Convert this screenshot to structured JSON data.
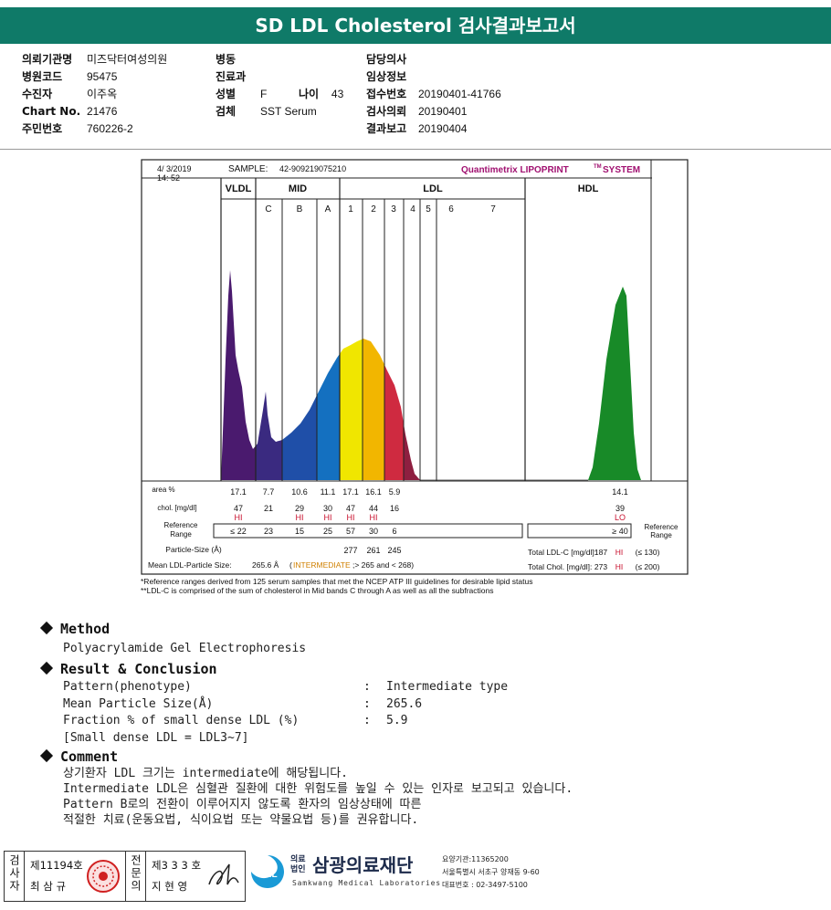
{
  "title": "SD LDL Cholesterol 검사결과보고서",
  "header": {
    "col1": [
      {
        "label": "의뢰기관명",
        "value": "미즈닥터여성의원"
      },
      {
        "label": "병원코드",
        "value": "95475"
      },
      {
        "label": "수진자",
        "value": "이주옥"
      },
      {
        "label": "Chart No.",
        "value": "21476"
      },
      {
        "label": "주민번호",
        "value": "760226-2"
      }
    ],
    "col2": [
      {
        "label": "병동",
        "value": ""
      },
      {
        "label": "진료과",
        "value": ""
      },
      {
        "label": "성별",
        "value": "F"
      },
      {
        "label": "검체",
        "value": "SST Serum"
      }
    ],
    "age_label": "나이",
    "age_value": "43",
    "col3": [
      {
        "label": "담당의사",
        "value": ""
      },
      {
        "label": "임상정보",
        "value": ""
      },
      {
        "label": "접수번호",
        "value": "20190401-41766"
      },
      {
        "label": "검사의뢰",
        "value": "20190401"
      },
      {
        "label": "결과보고",
        "value": "20190404"
      }
    ]
  },
  "chart_data": {
    "type": "area",
    "datetime": "4/ 3/2019",
    "time": "14: 52",
    "sample_label": "SAMPLE:",
    "sample_id": "42-909219075210",
    "system": "Quantimetrix LIPOPRINT",
    "system_tm": "TM",
    "system_suffix": "SYSTEM",
    "groups": [
      "VLDL",
      "MID",
      "LDL",
      "HDL"
    ],
    "bands": [
      "C",
      "B",
      "A",
      "1",
      "2",
      "3",
      "4",
      "5",
      "6",
      "7"
    ],
    "band_colors": {
      "VLDL": "#4a1a6e",
      "C": "#3a2a80",
      "B": "#1f4fa8",
      "A": "#1470c0",
      "1": "#f0e600",
      "2": "#f2b600",
      "3": "#cf2a40",
      "4": "#8e1f40",
      "5": "#8e1f40",
      "6": "#8e1f40",
      "7": "#8e1f40",
      "HDL": "#188a28"
    },
    "area_label": "area %",
    "area": [
      "17.1",
      "7.7",
      "10.6",
      "11.1",
      "17.1",
      "16.1",
      "5.9",
      "14.1"
    ],
    "chol_label": "chol. [mg/dl]",
    "chol": [
      "47",
      "21",
      "29",
      "30",
      "47",
      "44",
      "16",
      "39"
    ],
    "flags": [
      "HI",
      "",
      "HI",
      "HI",
      "HI",
      "HI",
      "",
      "LO"
    ],
    "ref_label": "Reference Range",
    "ref": [
      "≤ 22",
      "23",
      "15",
      "25",
      "57",
      "30",
      "6",
      "≥ 40"
    ],
    "particle_label": "Particle-Size (Å)",
    "particle": [
      "277",
      "261",
      "245"
    ],
    "mean_label": "Mean LDL-Particle Size:",
    "mean_value": "265.6 Å",
    "mean_class": "INTERMEDIATE",
    "mean_range": ";> 265 and < 268)",
    "total_ldl_label": "Total LDL-C [mg/dl]:",
    "total_ldl": "187",
    "total_ldl_flag": "HI",
    "total_ldl_ref": "(≤ 130)",
    "total_chol_label": "Total Chol. [mg/dl]:",
    "total_chol": "273",
    "total_chol_flag": "HI",
    "total_chol_ref": "(≤ 200)",
    "colors": {
      "flag": "#c8102e",
      "system": "#a01070",
      "intermediate": "#d08000"
    }
  },
  "footnotes": [
    "*Reference ranges derived from 125 serum samples that met the NCEP ATP III guidelines for desirable lipid status",
    "**LDL-C is comprised of the sum of cholesterol in Mid bands C through A as well as all the subfractions"
  ],
  "method": {
    "heading": "Method",
    "text": "Polyacrylamide Gel Electrophoresis"
  },
  "result": {
    "heading": "Result & Conclusion",
    "rows": [
      {
        "label": "Pattern(phenotype)",
        "value": "Intermediate type"
      },
      {
        "label": "Mean Particle Size(Å)",
        "value": "265.6"
      },
      {
        "label": "Fraction % of small dense LDL (%)",
        "value": "5.9"
      }
    ],
    "note": "[Small dense LDL = LDL3~7]",
    "colon": ":"
  },
  "comment": {
    "heading": "Comment",
    "lines": [
      "상기환자 LDL 크기는 intermediate에 해당됩니다.",
      "Intermediate LDL은 심혈관 질환에 대한 위험도를 높일 수 있는 인자로 보고되고 있습니다.",
      "Pattern B로의 전환이 이루어지지 않도록 환자의 임상상태에 따른",
      "적절한 치료(운동요법, 식이요법 또는 약물요법 등)를 권유합니다."
    ]
  },
  "signatures": {
    "box1_label": "검사자",
    "box1_no": "제11194호",
    "box1_name": "최 삼 규",
    "box2_label": "전문의",
    "box2_no": "제3 3 3 호",
    "box2_name": "지 현 영"
  },
  "org": {
    "badge": "SML",
    "kind_top": "의료",
    "kind_bottom": "법인",
    "name": "삼광의료재단",
    "name_en": "Samkwang Medical Laboratories",
    "code": "요양기관:11365200",
    "address": "서울특별시 서초구 양재동 9-60",
    "phone": "대표번호 : 02-3497-5100"
  }
}
